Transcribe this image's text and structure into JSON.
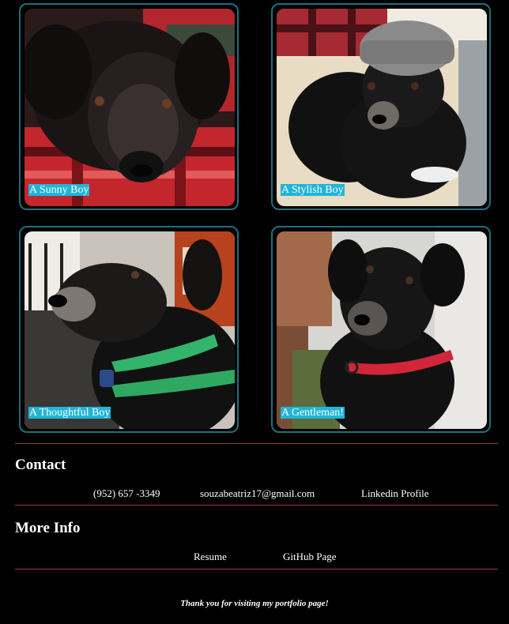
{
  "gallery": {
    "cards": [
      {
        "caption": "A Sunny Boy"
      },
      {
        "caption": "A Stylish Boy"
      },
      {
        "caption": "A Thoughtful Boy"
      },
      {
        "caption": "A Gentleman!"
      }
    ]
  },
  "contact": {
    "title": "Contact",
    "phone": "(952) 657 -3349",
    "email": "souzabeatriz17@gmail.com",
    "linkedin": "Linkedin Profile"
  },
  "more_info": {
    "title": "More Info",
    "resume": "Resume",
    "github": "GitHub Page"
  },
  "footer": {
    "note": "Thank you for visiting my portfolio page!"
  },
  "colors": {
    "background": "#000000",
    "card_border": "#1f6f7d",
    "caption_bg": "#1fb5d8",
    "divider": "#a0305c"
  }
}
